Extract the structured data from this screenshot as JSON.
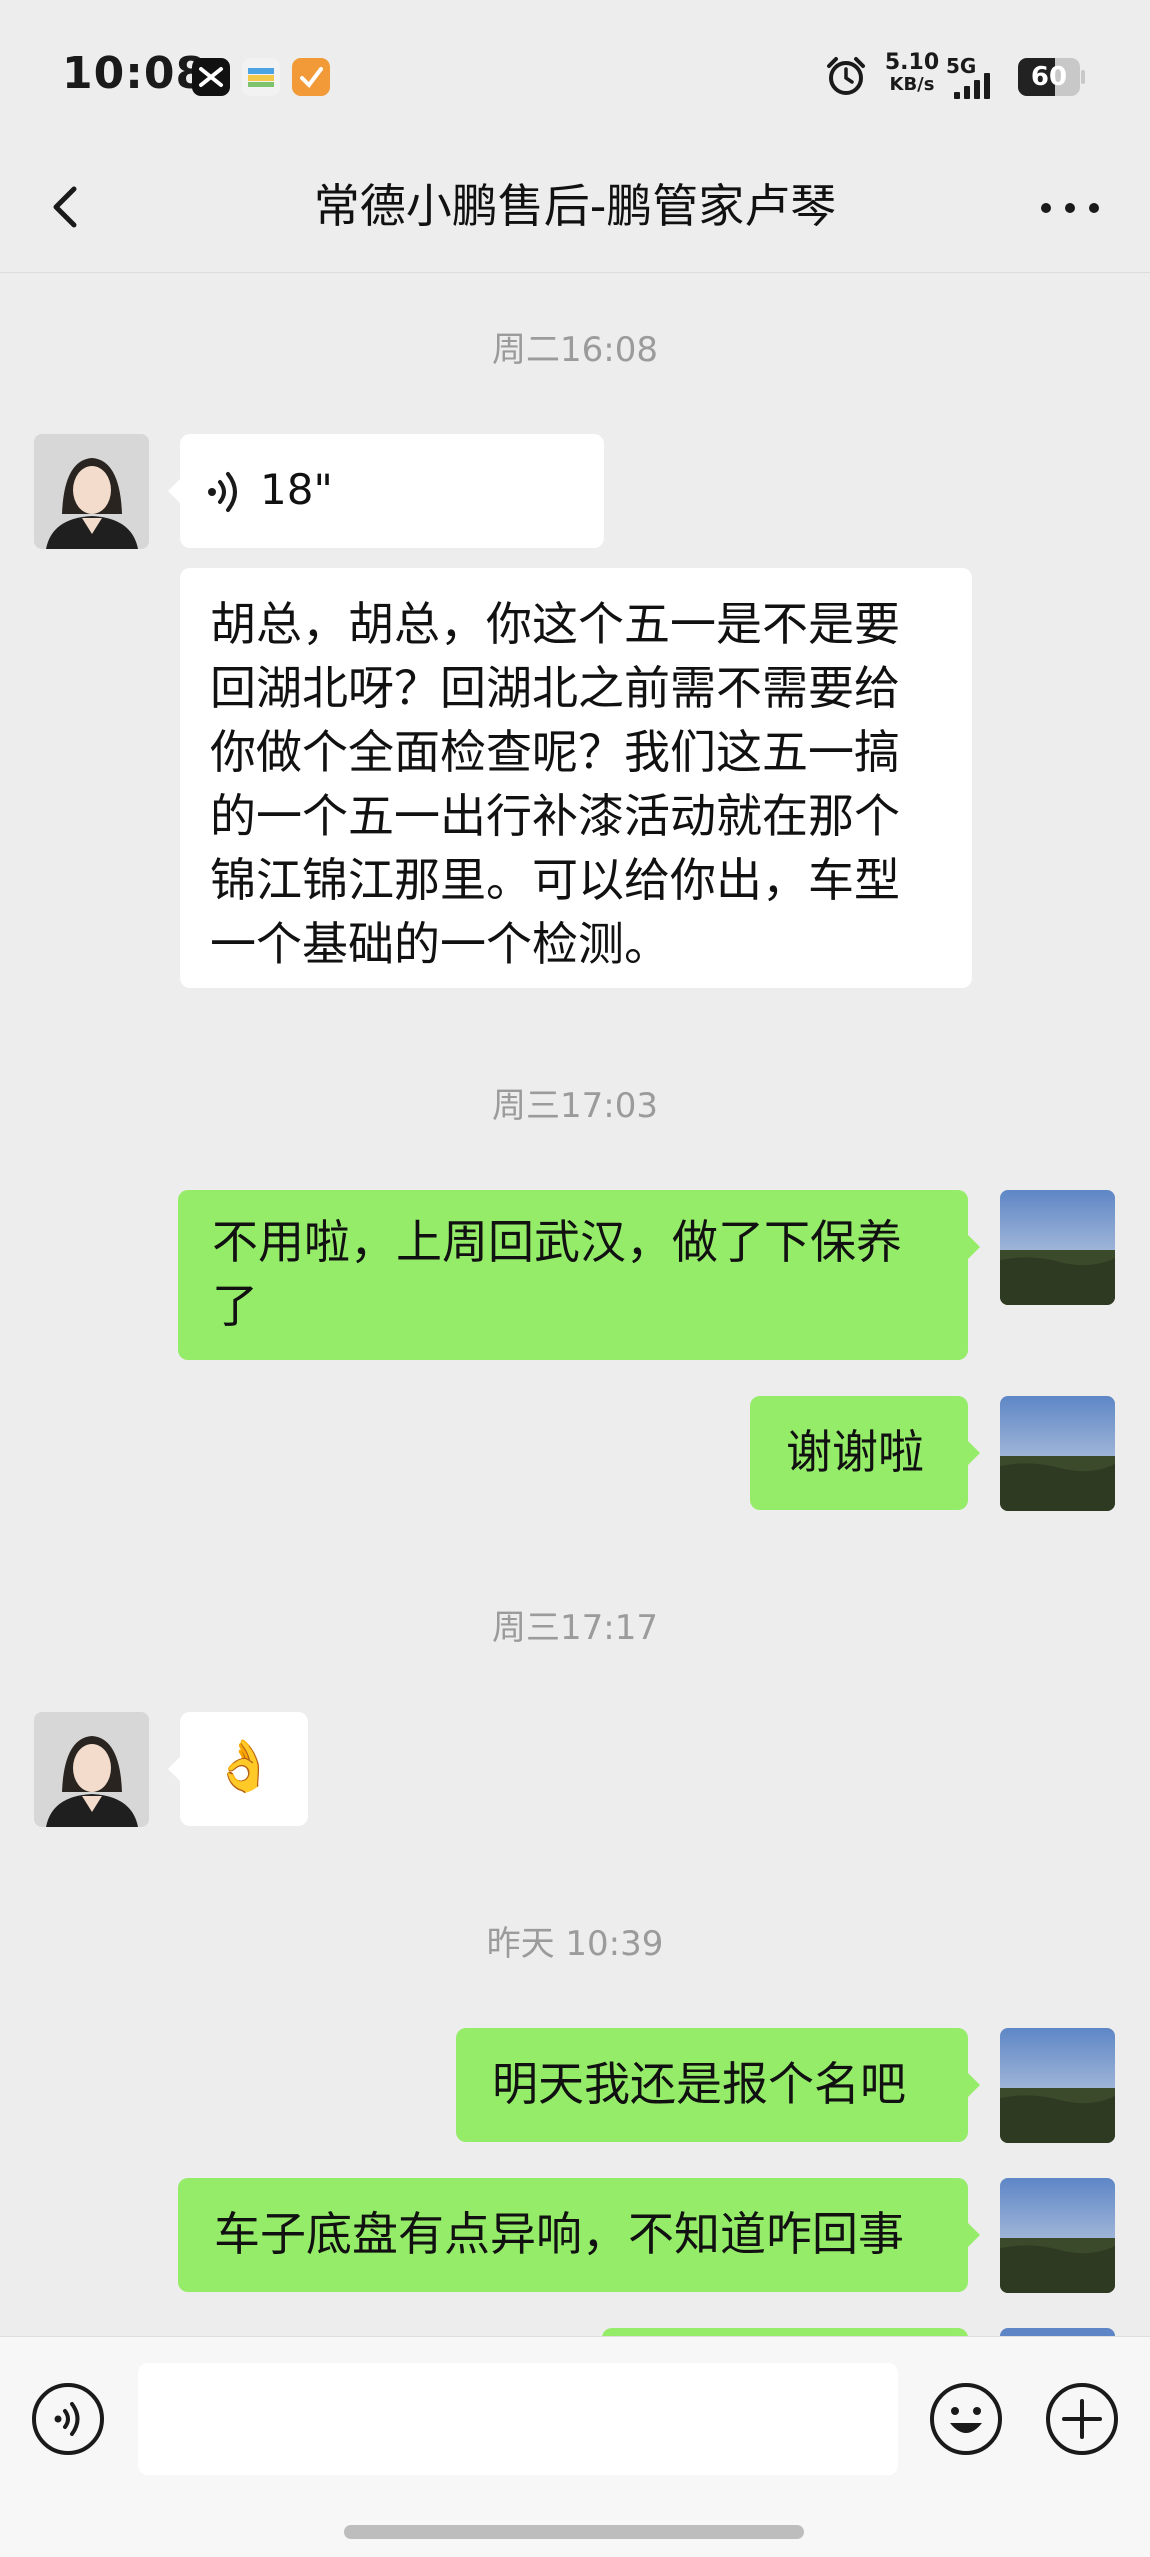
{
  "status_bar": {
    "time": "10:08",
    "speed_value": "5.10",
    "speed_unit": "KB/s",
    "network": "5G",
    "battery": "60",
    "icons": [
      "capcut-icon",
      "wallet-icon",
      "taobao-icon",
      "alarm-icon",
      "signal-icon",
      "battery-icon"
    ]
  },
  "nav": {
    "title": "常德小鹏售后-鹏管家卢琴",
    "back_icon": "chevron-left-icon",
    "more_icon": "more-dots-icon"
  },
  "timestamps": [
    "周二16:08",
    "周三17:03",
    "周三17:17",
    "昨天 10:39"
  ],
  "messages": {
    "voice": {
      "duration": "18\""
    },
    "m1": "胡总，胡总，你这个五一是不是要回湖北呀？回湖北之前需不需要给你做个全面检查呢？我们这五一搞的一个五一出行补漆活动就在那个锦江锦江那里。可以给你出，车型一个基础的一个检测。",
    "m2": "不用啦，上周回武汉，做了下保养了",
    "m3": "谢谢啦",
    "m4": "👌",
    "m5": "明天我还是报个名吧",
    "m6": "车子底盘有点异响，不知道咋回事"
  },
  "input_bar": {
    "placeholder": "",
    "icons": [
      "voice-input-icon",
      "emoji-icon",
      "plus-icon"
    ]
  },
  "colors": {
    "background": "#ededed",
    "incoming_bubble": "#ffffff",
    "outgoing_bubble": "#95ec69",
    "timestamp": "#9b9b9b"
  }
}
